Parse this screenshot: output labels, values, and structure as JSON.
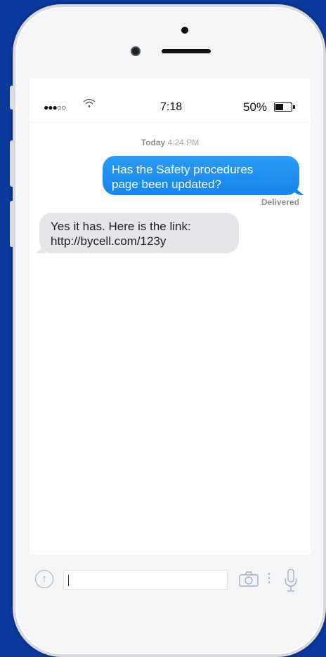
{
  "status": {
    "signal": "●●●○○",
    "time": "7:18",
    "battery_pct": "50%",
    "battery_level": 0.5
  },
  "thread": {
    "timestamp_day": "Today",
    "timestamp_time": "4:24 PM",
    "messages": [
      {
        "direction": "outgoing",
        "text_line1": "Has the Safety procedures",
        "text_line2": "page been updated?"
      },
      {
        "direction": "incoming",
        "text_line1": "Yes it has. Here is the link:",
        "text_line2": "http://bycell.com/123y"
      }
    ],
    "delivered_label": "Delivered"
  },
  "composer": {
    "value": "",
    "icons": [
      "upload-icon",
      "camera-icon",
      "more-icon",
      "microphone-icon"
    ]
  },
  "colors": {
    "background": "#0a3a9e",
    "outgoing_bubble": "#1f8ef1",
    "incoming_bubble": "#e5e5ea"
  }
}
